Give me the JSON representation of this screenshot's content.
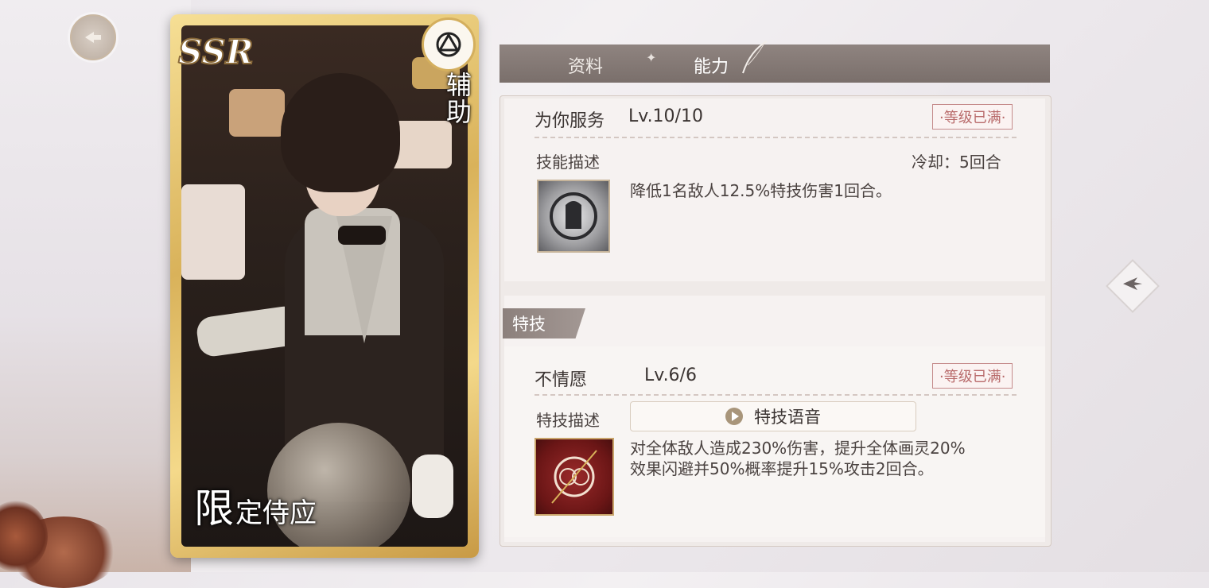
{
  "card": {
    "rarity": "SSR",
    "role": "辅助",
    "name_first": "限",
    "name_rest": "定侍应",
    "role_icon": "triangle-circle-icon"
  },
  "tabs": [
    {
      "label": "资料"
    },
    {
      "label": "能力"
    }
  ],
  "skill": {
    "name": "为你服务",
    "level": "Lv.10/10",
    "badge": "·等级已满·",
    "desc_label": "技能描述",
    "cooldown": "冷却：5回合",
    "description": "降低1名敌人12.5%特技伤害1回合。"
  },
  "special": {
    "section": "特技",
    "name": "不情愿",
    "level": "Lv.6/6",
    "badge": "·等级已满·",
    "desc_label": "特技描述",
    "voice_button": "特技语音",
    "description_line1": "对全体敌人造成230%伤害，提升全体画灵20%",
    "description_line2": "效果闪避并50%概率提升15%攻击2回合。"
  },
  "colors": {
    "tabbar": "#7a6f6b",
    "badge": "#b86a6a",
    "card_frame": "#d9b25a"
  }
}
